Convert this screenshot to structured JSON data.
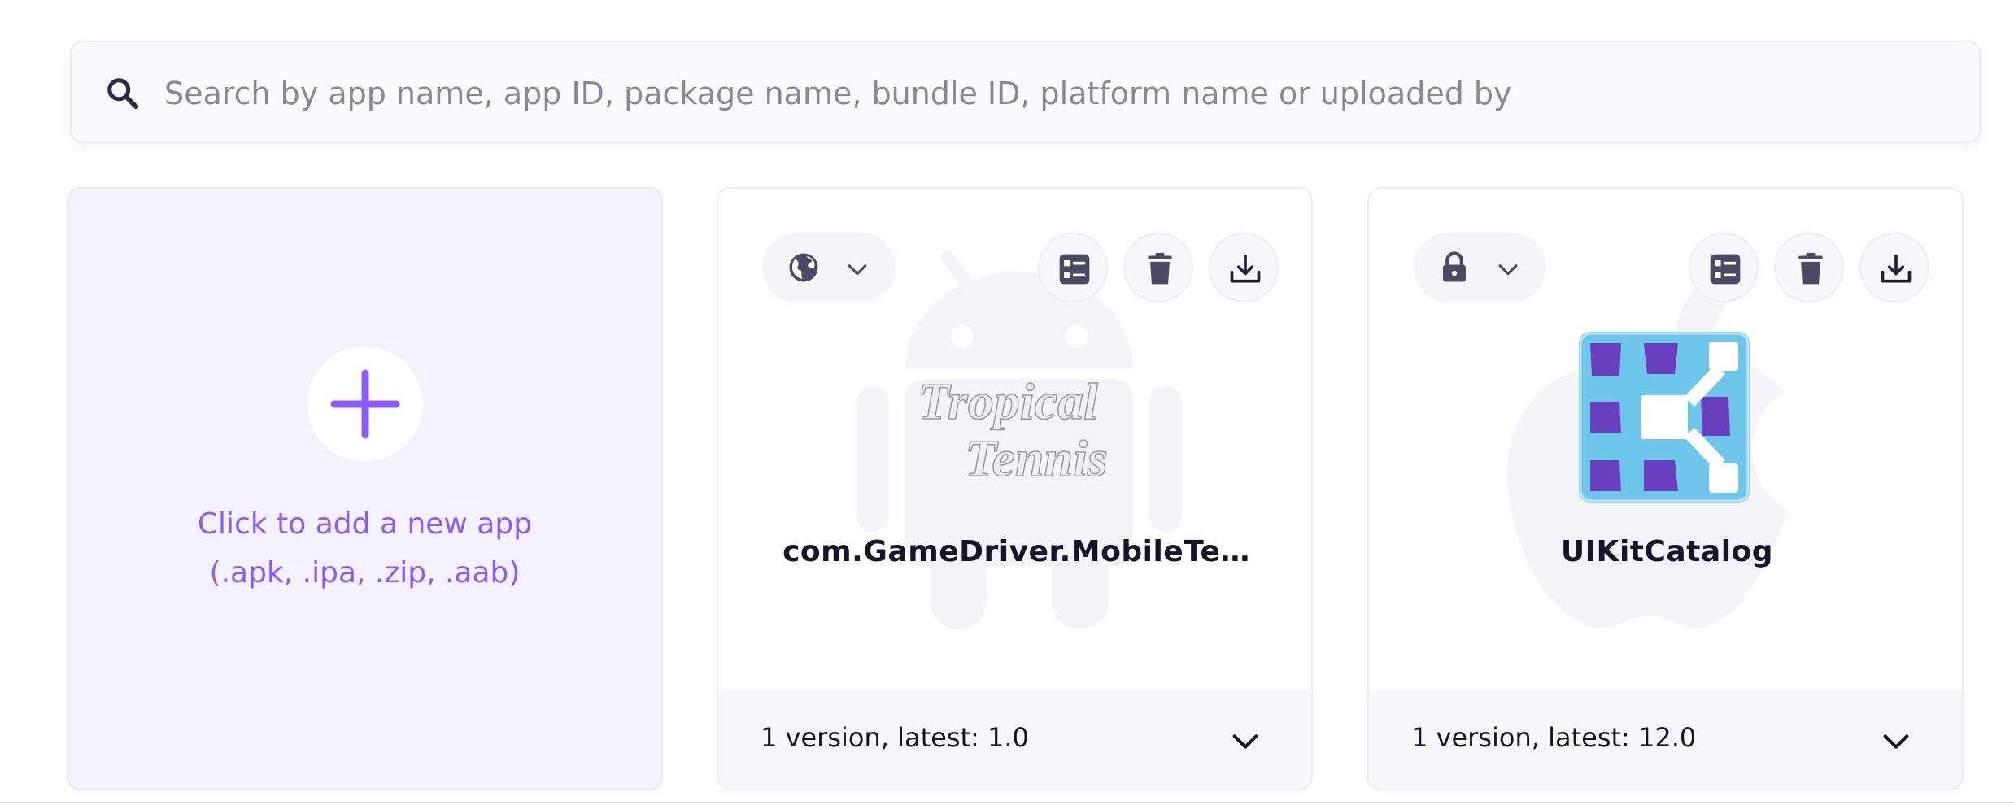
{
  "search": {
    "placeholder": "Search by app name, app ID, package name, bundle ID, platform name or uploaded by",
    "value": "",
    "icon": "search-icon"
  },
  "add_card": {
    "line1": "Click to add a new app",
    "line2": "(.apk, .ipa, .zip, .aab)",
    "icon": "plus-icon"
  },
  "apps": [
    {
      "name": "com.GameDriver.MobileTe…",
      "platform": "android",
      "visibility_icon": "globe-icon",
      "logo_text": [
        "Tropical",
        "Tennis"
      ],
      "versions_text": "1 version, latest: 1.0"
    },
    {
      "name": "UIKitCatalog",
      "platform": "ios",
      "visibility_icon": "lock-icon",
      "versions_text": "1 version, latest: 12.0"
    }
  ],
  "colors": {
    "accent": "#8b5cf6",
    "add_card_bg": "#f4f1ff",
    "icon_dark": "#4a4a63",
    "logo_blue": "#6ec6ea",
    "logo_purple": "#6a3fbf"
  }
}
